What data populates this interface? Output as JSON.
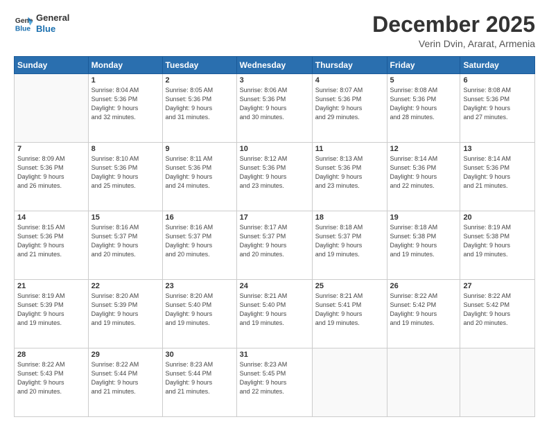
{
  "header": {
    "logo_line1": "General",
    "logo_line2": "Blue",
    "title": "December 2025",
    "subtitle": "Verin Dvin, Ararat, Armenia"
  },
  "weekdays": [
    "Sunday",
    "Monday",
    "Tuesday",
    "Wednesday",
    "Thursday",
    "Friday",
    "Saturday"
  ],
  "weeks": [
    [
      {
        "day": "",
        "sunrise": "",
        "sunset": "",
        "daylight": ""
      },
      {
        "day": "1",
        "sunrise": "Sunrise: 8:04 AM",
        "sunset": "Sunset: 5:36 PM",
        "daylight": "Daylight: 9 hours and 32 minutes."
      },
      {
        "day": "2",
        "sunrise": "Sunrise: 8:05 AM",
        "sunset": "Sunset: 5:36 PM",
        "daylight": "Daylight: 9 hours and 31 minutes."
      },
      {
        "day": "3",
        "sunrise": "Sunrise: 8:06 AM",
        "sunset": "Sunset: 5:36 PM",
        "daylight": "Daylight: 9 hours and 30 minutes."
      },
      {
        "day": "4",
        "sunrise": "Sunrise: 8:07 AM",
        "sunset": "Sunset: 5:36 PM",
        "daylight": "Daylight: 9 hours and 29 minutes."
      },
      {
        "day": "5",
        "sunrise": "Sunrise: 8:08 AM",
        "sunset": "Sunset: 5:36 PM",
        "daylight": "Daylight: 9 hours and 28 minutes."
      },
      {
        "day": "6",
        "sunrise": "Sunrise: 8:08 AM",
        "sunset": "Sunset: 5:36 PM",
        "daylight": "Daylight: 9 hours and 27 minutes."
      }
    ],
    [
      {
        "day": "7",
        "sunrise": "Sunrise: 8:09 AM",
        "sunset": "Sunset: 5:36 PM",
        "daylight": "Daylight: 9 hours and 26 minutes."
      },
      {
        "day": "8",
        "sunrise": "Sunrise: 8:10 AM",
        "sunset": "Sunset: 5:36 PM",
        "daylight": "Daylight: 9 hours and 25 minutes."
      },
      {
        "day": "9",
        "sunrise": "Sunrise: 8:11 AM",
        "sunset": "Sunset: 5:36 PM",
        "daylight": "Daylight: 9 hours and 24 minutes."
      },
      {
        "day": "10",
        "sunrise": "Sunrise: 8:12 AM",
        "sunset": "Sunset: 5:36 PM",
        "daylight": "Daylight: 9 hours and 23 minutes."
      },
      {
        "day": "11",
        "sunrise": "Sunrise: 8:13 AM",
        "sunset": "Sunset: 5:36 PM",
        "daylight": "Daylight: 9 hours and 23 minutes."
      },
      {
        "day": "12",
        "sunrise": "Sunrise: 8:14 AM",
        "sunset": "Sunset: 5:36 PM",
        "daylight": "Daylight: 9 hours and 22 minutes."
      },
      {
        "day": "13",
        "sunrise": "Sunrise: 8:14 AM",
        "sunset": "Sunset: 5:36 PM",
        "daylight": "Daylight: 9 hours and 21 minutes."
      }
    ],
    [
      {
        "day": "14",
        "sunrise": "Sunrise: 8:15 AM",
        "sunset": "Sunset: 5:36 PM",
        "daylight": "Daylight: 9 hours and 21 minutes."
      },
      {
        "day": "15",
        "sunrise": "Sunrise: 8:16 AM",
        "sunset": "Sunset: 5:37 PM",
        "daylight": "Daylight: 9 hours and 20 minutes."
      },
      {
        "day": "16",
        "sunrise": "Sunrise: 8:16 AM",
        "sunset": "Sunset: 5:37 PM",
        "daylight": "Daylight: 9 hours and 20 minutes."
      },
      {
        "day": "17",
        "sunrise": "Sunrise: 8:17 AM",
        "sunset": "Sunset: 5:37 PM",
        "daylight": "Daylight: 9 hours and 20 minutes."
      },
      {
        "day": "18",
        "sunrise": "Sunrise: 8:18 AM",
        "sunset": "Sunset: 5:37 PM",
        "daylight": "Daylight: 9 hours and 19 minutes."
      },
      {
        "day": "19",
        "sunrise": "Sunrise: 8:18 AM",
        "sunset": "Sunset: 5:38 PM",
        "daylight": "Daylight: 9 hours and 19 minutes."
      },
      {
        "day": "20",
        "sunrise": "Sunrise: 8:19 AM",
        "sunset": "Sunset: 5:38 PM",
        "daylight": "Daylight: 9 hours and 19 minutes."
      }
    ],
    [
      {
        "day": "21",
        "sunrise": "Sunrise: 8:19 AM",
        "sunset": "Sunset: 5:39 PM",
        "daylight": "Daylight: 9 hours and 19 minutes."
      },
      {
        "day": "22",
        "sunrise": "Sunrise: 8:20 AM",
        "sunset": "Sunset: 5:39 PM",
        "daylight": "Daylight: 9 hours and 19 minutes."
      },
      {
        "day": "23",
        "sunrise": "Sunrise: 8:20 AM",
        "sunset": "Sunset: 5:40 PM",
        "daylight": "Daylight: 9 hours and 19 minutes."
      },
      {
        "day": "24",
        "sunrise": "Sunrise: 8:21 AM",
        "sunset": "Sunset: 5:40 PM",
        "daylight": "Daylight: 9 hours and 19 minutes."
      },
      {
        "day": "25",
        "sunrise": "Sunrise: 8:21 AM",
        "sunset": "Sunset: 5:41 PM",
        "daylight": "Daylight: 9 hours and 19 minutes."
      },
      {
        "day": "26",
        "sunrise": "Sunrise: 8:22 AM",
        "sunset": "Sunset: 5:42 PM",
        "daylight": "Daylight: 9 hours and 19 minutes."
      },
      {
        "day": "27",
        "sunrise": "Sunrise: 8:22 AM",
        "sunset": "Sunset: 5:42 PM",
        "daylight": "Daylight: 9 hours and 20 minutes."
      }
    ],
    [
      {
        "day": "28",
        "sunrise": "Sunrise: 8:22 AM",
        "sunset": "Sunset: 5:43 PM",
        "daylight": "Daylight: 9 hours and 20 minutes."
      },
      {
        "day": "29",
        "sunrise": "Sunrise: 8:22 AM",
        "sunset": "Sunset: 5:44 PM",
        "daylight": "Daylight: 9 hours and 21 minutes."
      },
      {
        "day": "30",
        "sunrise": "Sunrise: 8:23 AM",
        "sunset": "Sunset: 5:44 PM",
        "daylight": "Daylight: 9 hours and 21 minutes."
      },
      {
        "day": "31",
        "sunrise": "Sunrise: 8:23 AM",
        "sunset": "Sunset: 5:45 PM",
        "daylight": "Daylight: 9 hours and 22 minutes."
      },
      {
        "day": "",
        "sunrise": "",
        "sunset": "",
        "daylight": ""
      },
      {
        "day": "",
        "sunrise": "",
        "sunset": "",
        "daylight": ""
      },
      {
        "day": "",
        "sunrise": "",
        "sunset": "",
        "daylight": ""
      }
    ]
  ]
}
